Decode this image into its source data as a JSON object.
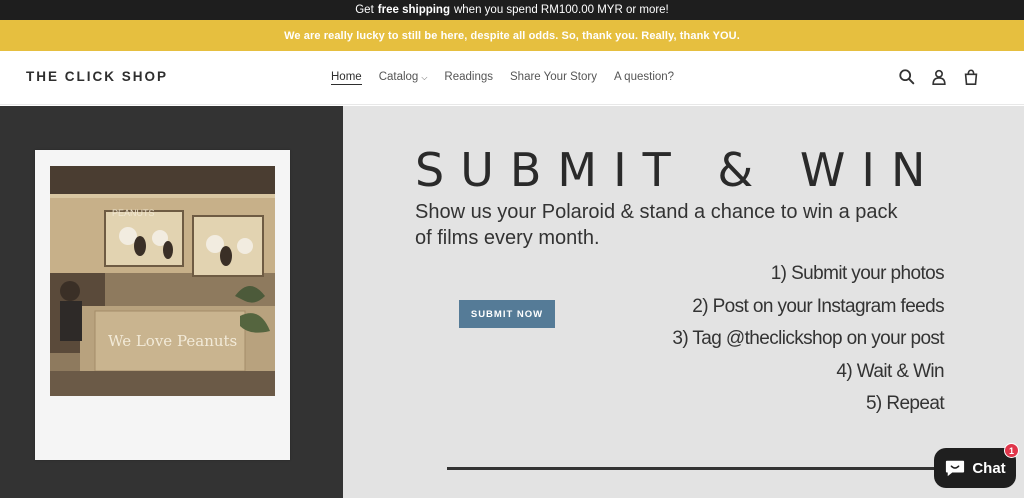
{
  "topbar": {
    "before": "Get",
    "bold": "free shipping",
    "after": "when you spend RM100.00 MYR or more!"
  },
  "announcement": "We are really lucky to still be here, despite all odds. So, thank you. Really, thank YOU.",
  "header": {
    "logo": "THE CLICK SHOP",
    "nav": {
      "home": "Home",
      "catalog": "Catalog",
      "readings": "Readings",
      "share": "Share Your Story",
      "question": "A question?"
    },
    "icons": [
      "search-icon",
      "account-icon",
      "cart-icon"
    ]
  },
  "hero": {
    "photo_sign": "We Love Peanuts",
    "photo_brand": "PEANUTS",
    "title": "SUBMIT & WIN",
    "subtitle": "Show us your Polaroid & stand a chance to win a pack of films every month.",
    "steps": [
      "1) Submit your photos",
      "2) Post on your Instagram feeds",
      "3) Tag @theclickshop on your post",
      "4) Wait & Win",
      "5) Repeat"
    ],
    "button": "SUBMIT NOW"
  },
  "chat": {
    "label": "Chat",
    "badge": "1"
  },
  "colors": {
    "topbar": "#1e1e1e",
    "announcement": "#e6bf3f",
    "button": "#557b97",
    "hero_left": "#333333",
    "hero_right": "#e3e3e3"
  }
}
